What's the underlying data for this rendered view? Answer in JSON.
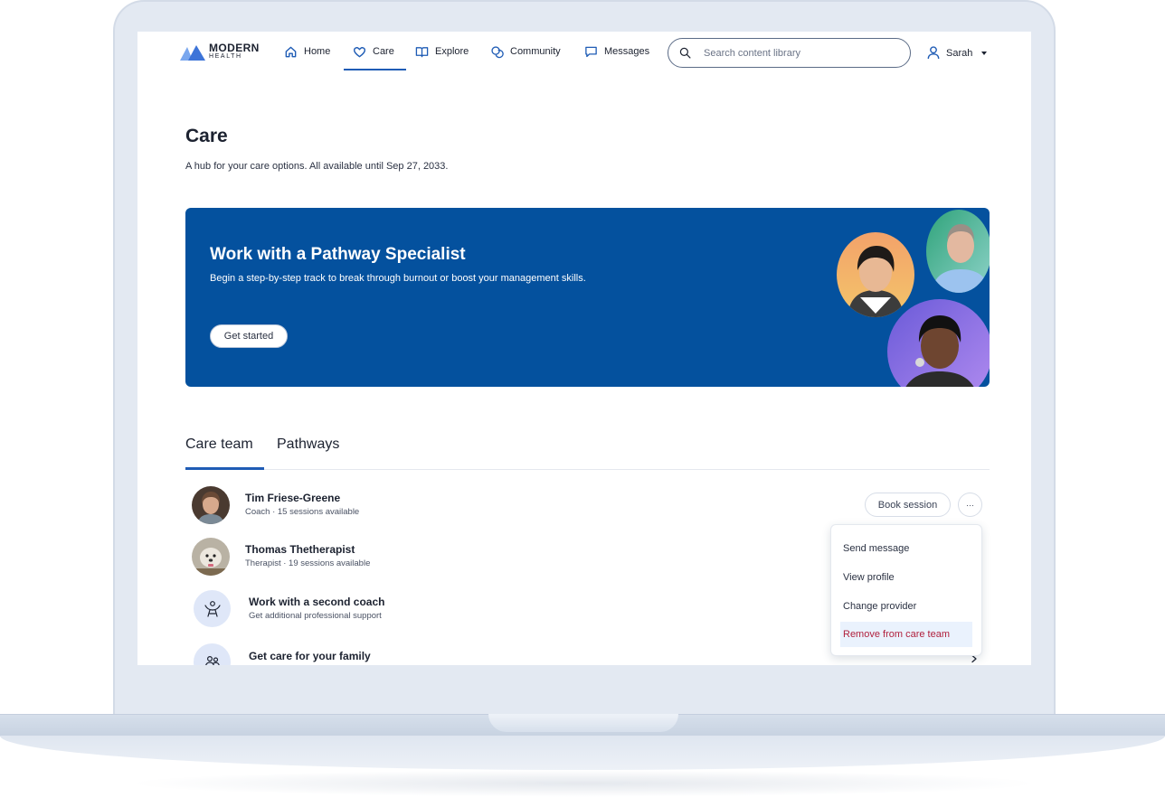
{
  "nav": {
    "logo_line1": "MODERN",
    "logo_line2": "HEALTH",
    "items": [
      {
        "label": "Home",
        "icon": "home-icon"
      },
      {
        "label": "Care",
        "icon": "heart-icon",
        "active": true
      },
      {
        "label": "Explore",
        "icon": "book-icon"
      },
      {
        "label": "Community",
        "icon": "community-icon"
      },
      {
        "label": "Messages",
        "icon": "message-icon"
      }
    ],
    "search_placeholder": "Search content library",
    "user_name": "Sarah"
  },
  "page": {
    "title": "Care",
    "subtitle": "A hub for your care options. All available until Sep 27, 2033."
  },
  "banner": {
    "title": "Work with a Pathway Specialist",
    "text": "Begin a step-by-step track to break through burnout or boost your management skills.",
    "button_label": "Get started",
    "background": "#04519e"
  },
  "tabs": [
    {
      "label": "Care team",
      "active": true
    },
    {
      "label": "Pathways",
      "active": false
    }
  ],
  "care_team": [
    {
      "name": "Tim Friese-Greene",
      "meta": "Coach · 15 sessions available"
    },
    {
      "name": "Thomas Thetherapist",
      "meta": "Therapist · 19 sessions available"
    }
  ],
  "options": [
    {
      "name": "Work with a second coach",
      "meta": "Get additional professional support",
      "icon": "coach-icon"
    },
    {
      "name": "Get care for your family",
      "icon": "family-icon"
    }
  ],
  "actions": {
    "book_label": "Book session",
    "more_label": "···"
  },
  "menu": {
    "items": [
      "Send message",
      "View profile",
      "Change provider",
      "Remove from care team"
    ]
  },
  "colors": {
    "accent": "#1f5cb5",
    "danger": "#b0203d",
    "banner": "#04519e"
  }
}
